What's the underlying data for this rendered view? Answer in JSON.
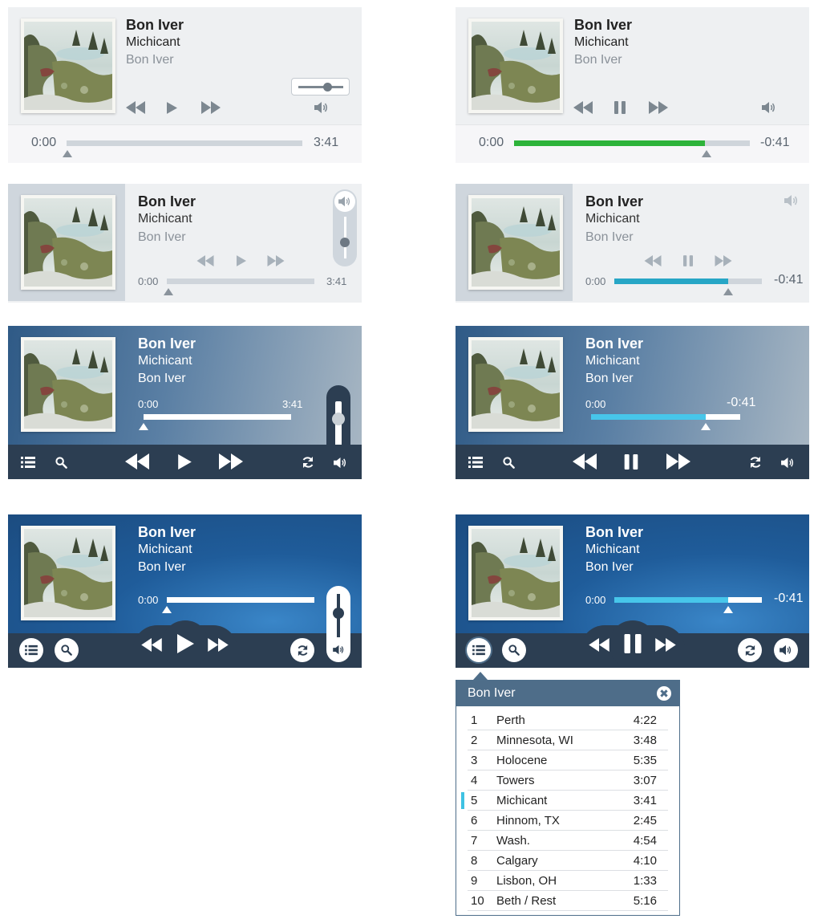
{
  "track": {
    "artist": "Bon Iver",
    "song": "Michicant",
    "album": "Bon Iver"
  },
  "times": {
    "start": "0:00",
    "duration": "3:41",
    "remaining": "-0:41"
  },
  "progress": {
    "paused_state": 0.0,
    "playing_state": 0.81
  },
  "volume": {
    "level": 0.55
  },
  "colors": {
    "green_progress": "#2db33a",
    "teal_progress": "#27a6c6",
    "cyan_progress": "#47c6ea",
    "dark_bar": "#2c3e52",
    "playlist_header": "#4e6d89",
    "active_marker": "#3fc2e3"
  },
  "icons": [
    "rewind-icon",
    "play-icon",
    "pause-icon",
    "fast-forward-icon",
    "volume-icon",
    "playlist-icon",
    "search-icon",
    "repeat-icon",
    "close-icon"
  ],
  "playlist": {
    "title": "Bon Iver",
    "active_index": 4,
    "items": [
      {
        "num": "1",
        "title": "Perth",
        "duration": "4:22"
      },
      {
        "num": "2",
        "title": "Minnesota, WI",
        "duration": "3:48"
      },
      {
        "num": "3",
        "title": "Holocene",
        "duration": "5:35"
      },
      {
        "num": "4",
        "title": "Towers",
        "duration": "3:07"
      },
      {
        "num": "5",
        "title": "Michicant",
        "duration": "3:41"
      },
      {
        "num": "6",
        "title": "Hinnom, TX",
        "duration": "2:45"
      },
      {
        "num": "7",
        "title": "Wash.",
        "duration": "4:54"
      },
      {
        "num": "8",
        "title": "Calgary",
        "duration": "4:10"
      },
      {
        "num": "9",
        "title": "Lisbon, OH",
        "duration": "1:33"
      },
      {
        "num": "10",
        "title": "Beth / Rest",
        "duration": "5:16"
      }
    ]
  }
}
